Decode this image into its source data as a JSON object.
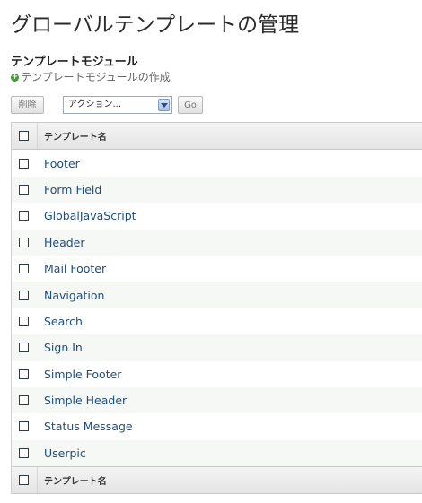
{
  "page": {
    "title": "グローバルテンプレートの管理"
  },
  "section": {
    "title": "テンプレートモジュール",
    "create_link": "テンプレートモジュールの作成",
    "create_icon": "plus-circle-icon"
  },
  "toolbar": {
    "delete_label": "削除",
    "action_select": "アクション...",
    "go_label": "Go"
  },
  "table": {
    "header": "テンプレート名",
    "footer": "テンプレート名",
    "rows": [
      "Footer",
      "Form Field",
      "GlobalJavaScript",
      "Header",
      "Mail Footer",
      "Navigation",
      "Search",
      "Sign In",
      "Simple Footer",
      "Simple Header",
      "Status Message",
      "Userpic"
    ]
  },
  "colors": {
    "link": "#1f4d7a",
    "plus_icon": "#3f9b2f"
  }
}
